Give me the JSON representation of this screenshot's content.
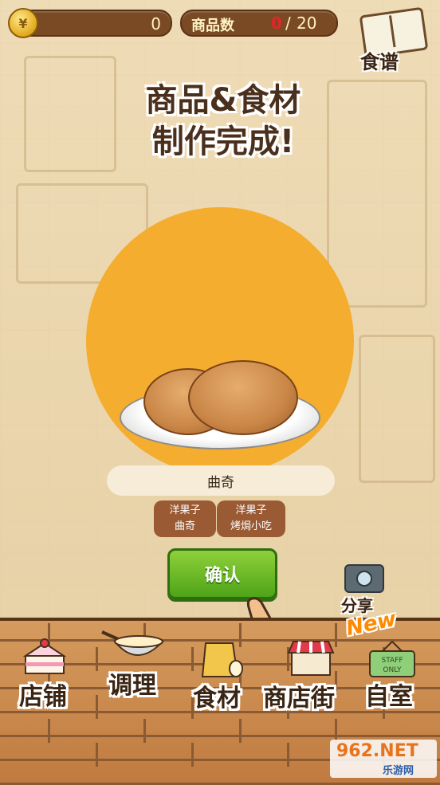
{
  "topbar": {
    "coin_symbol": "¥",
    "coins": "0",
    "item_count_label": "商品数",
    "item_count_current": "0",
    "item_count_sep": "/",
    "item_count_max": "20"
  },
  "recipe": {
    "label": "食谱"
  },
  "headline": {
    "line1": "商品&食材",
    "line2": "制作完成!"
  },
  "item": {
    "name": "曲奇",
    "tags": [
      {
        "line1": "洋果子",
        "line2": "曲奇"
      },
      {
        "line1": "洋果子",
        "line2": "烤焗小吃"
      }
    ]
  },
  "confirm_label": "确认",
  "share_label": "分享",
  "new_badge": "New",
  "nav": [
    {
      "label": "店铺",
      "icon": "cake-icon"
    },
    {
      "label": "调理",
      "icon": "mixing-bowl-icon"
    },
    {
      "label": "食材",
      "icon": "ingredient-bag-icon"
    },
    {
      "label": "商店街",
      "icon": "shop-awning-icon"
    },
    {
      "label": "自室",
      "icon": "staff-only-sign-icon"
    }
  ],
  "watermark": {
    "main": "962.NET",
    "sub": "乐游网"
  },
  "colors": {
    "accent_orange": "#f4ad2e",
    "confirm_green": "#4ea418",
    "tag_brown": "#9a5a34",
    "count_red": "#e02626"
  }
}
